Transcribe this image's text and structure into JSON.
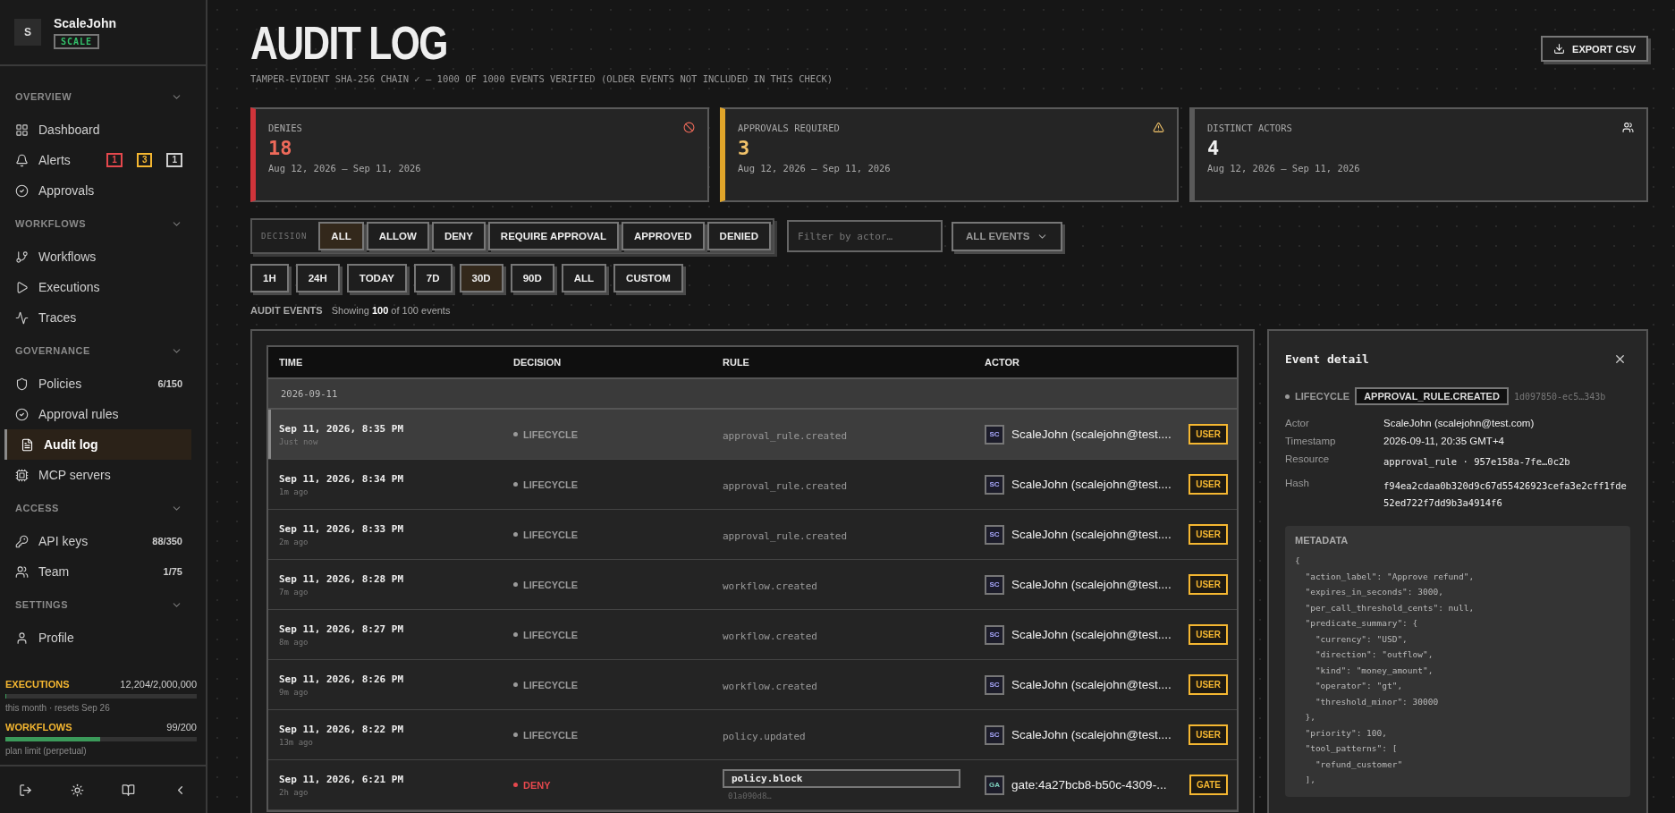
{
  "workspace": {
    "initial": "S",
    "name": "ScaleJohn",
    "plan": "SCALE"
  },
  "nav": [
    {
      "title": "OVERVIEW",
      "items": [
        {
          "label": "Dashboard",
          "selected": false
        },
        {
          "label": "Alerts",
          "selected": false,
          "badges": [
            {
              "text": "1",
              "color": "#e5484d"
            },
            {
              "text": "3",
              "color": "#f5b731"
            },
            {
              "text": "1",
              "color": "#cfcfcf"
            }
          ]
        },
        {
          "label": "Approvals",
          "selected": false
        }
      ]
    },
    {
      "title": "WORKFLOWS",
      "items": [
        {
          "label": "Workflows",
          "selected": false
        },
        {
          "label": "Executions",
          "selected": false
        },
        {
          "label": "Traces",
          "selected": false
        }
      ]
    },
    {
      "title": "GOVERNANCE",
      "items": [
        {
          "label": "Policies",
          "selected": false,
          "count": "6/150"
        },
        {
          "label": "Approval rules",
          "selected": false
        },
        {
          "label": "Audit log",
          "selected": true
        },
        {
          "label": "MCP servers",
          "selected": false
        }
      ]
    },
    {
      "title": "ACCESS",
      "items": [
        {
          "label": "API keys",
          "selected": false,
          "count": "88/350"
        },
        {
          "label": "Team",
          "selected": false,
          "count": "1/75"
        }
      ]
    },
    {
      "title": "SETTINGS",
      "items": [
        {
          "label": "Profile",
          "selected": false
        }
      ]
    }
  ],
  "usage": [
    {
      "title": "EXECUTIONS",
      "value": "12,204/2,000,000",
      "level": 0.006,
      "caption": "this month · resets Sep 26",
      "color": "#3b9a5a"
    },
    {
      "title": "WORKFLOWS",
      "value": "99/200",
      "level": 0.495,
      "caption": "plan limit (perpetual)",
      "color": "#3b9a5a"
    }
  ],
  "header": {
    "title": "AUDIT LOG",
    "subtitle": "TAMPER-EVIDENT SHA-256 CHAIN ✓ — 1000 OF 1000 EVENTS VERIFIED (OLDER EVENTS NOT INCLUDED IN THIS CHECK)",
    "export": "EXPORT CSV"
  },
  "stats": [
    {
      "kind": "deny",
      "label": "DENIES",
      "value": "18",
      "range": "Aug 12, 2026 – Sep 11, 2026"
    },
    {
      "kind": "approval",
      "label": "APPROVALS REQUIRED",
      "value": "3",
      "range": "Aug 12, 2026 – Sep 11, 2026"
    },
    {
      "kind": "actors",
      "label": "DISTINCT ACTORS",
      "value": "4",
      "range": "Aug 12, 2026 – Sep 11, 2026"
    }
  ],
  "decision_filter": {
    "label": "DECISION",
    "options": [
      {
        "label": "ALL",
        "selected": true
      },
      {
        "label": "ALLOW",
        "selected": false
      },
      {
        "label": "DENY",
        "selected": false
      },
      {
        "label": "REQUIRE APPROVAL",
        "selected": false
      },
      {
        "label": "APPROVED",
        "selected": false
      },
      {
        "label": "DENIED",
        "selected": false
      }
    ]
  },
  "actor_filter": {
    "placeholder": "Filter by actor…"
  },
  "event_select": {
    "value": "ALL EVENTS"
  },
  "time_filter": [
    {
      "label": "1H",
      "selected": false
    },
    {
      "label": "24H",
      "selected": false
    },
    {
      "label": "TODAY",
      "selected": false
    },
    {
      "label": "7D",
      "selected": false
    },
    {
      "label": "30D",
      "selected": true
    },
    {
      "label": "90D",
      "selected": false
    },
    {
      "label": "ALL",
      "selected": false
    },
    {
      "label": "CUSTOM",
      "selected": false
    }
  ],
  "events_summary": {
    "title": "AUDIT EVENTS",
    "text": "Showing **100** of 100 events"
  },
  "table": {
    "columns": [
      "TIME",
      "DECISION",
      "RULE",
      "ACTOR"
    ],
    "date_group": "2026-09-11",
    "rows": [
      {
        "selected": true,
        "time": "Sep 11, 2026, 8:35 PM",
        "ago": "Just now",
        "decision": {
          "kind": "lifecycle",
          "label": "LIFECYCLE"
        },
        "rule": {
          "kind": "plain",
          "text": "approval_rule.created"
        },
        "actor": {
          "initials": "SC",
          "name": "ScaleJohn (scalejohn@test....",
          "role": "USER"
        }
      },
      {
        "selected": false,
        "time": "Sep 11, 2026, 8:34 PM",
        "ago": "1m ago",
        "decision": {
          "kind": "lifecycle",
          "label": "LIFECYCLE"
        },
        "rule": {
          "kind": "plain",
          "text": "approval_rule.created"
        },
        "actor": {
          "initials": "SC",
          "name": "ScaleJohn (scalejohn@test....",
          "role": "USER"
        }
      },
      {
        "selected": false,
        "time": "Sep 11, 2026, 8:33 PM",
        "ago": "2m ago",
        "decision": {
          "kind": "lifecycle",
          "label": "LIFECYCLE"
        },
        "rule": {
          "kind": "plain",
          "text": "approval_rule.created"
        },
        "actor": {
          "initials": "SC",
          "name": "ScaleJohn (scalejohn@test....",
          "role": "USER"
        }
      },
      {
        "selected": false,
        "time": "Sep 11, 2026, 8:28 PM",
        "ago": "7m ago",
        "decision": {
          "kind": "lifecycle",
          "label": "LIFECYCLE"
        },
        "rule": {
          "kind": "plain",
          "text": "workflow.created"
        },
        "actor": {
          "initials": "SC",
          "name": "ScaleJohn (scalejohn@test....",
          "role": "USER"
        }
      },
      {
        "selected": false,
        "time": "Sep 11, 2026, 8:27 PM",
        "ago": "8m ago",
        "decision": {
          "kind": "lifecycle",
          "label": "LIFECYCLE"
        },
        "rule": {
          "kind": "plain",
          "text": "workflow.created"
        },
        "actor": {
          "initials": "SC",
          "name": "ScaleJohn (scalejohn@test....",
          "role": "USER"
        }
      },
      {
        "selected": false,
        "time": "Sep 11, 2026, 8:26 PM",
        "ago": "9m ago",
        "decision": {
          "kind": "lifecycle",
          "label": "LIFECYCLE"
        },
        "rule": {
          "kind": "plain",
          "text": "workflow.created"
        },
        "actor": {
          "initials": "SC",
          "name": "ScaleJohn (scalejohn@test....",
          "role": "USER"
        }
      },
      {
        "selected": false,
        "time": "Sep 11, 2026, 8:22 PM",
        "ago": "13m ago",
        "decision": {
          "kind": "lifecycle",
          "label": "LIFECYCLE"
        },
        "rule": {
          "kind": "plain",
          "text": "policy.updated"
        },
        "actor": {
          "initials": "SC",
          "name": "ScaleJohn (scalejohn@test....",
          "role": "USER"
        }
      },
      {
        "selected": false,
        "time": "Sep 11, 2026, 6:21 PM",
        "ago": "2h ago",
        "decision": {
          "kind": "deny",
          "label": "DENY"
        },
        "rule": {
          "kind": "boxed",
          "text": "policy.block",
          "sub": "01a090d8…"
        },
        "actor": {
          "initials": "GA",
          "name": "gate:4a27bcb8-b50c-4309-...",
          "role": "GATE"
        }
      }
    ]
  },
  "detail": {
    "title": "Event detail",
    "category": "LIFECYCLE",
    "event": "APPROVAL_RULE.CREATED",
    "id": "1d097850-ec5…343b",
    "fields": [
      {
        "label": "Actor",
        "value": "ScaleJohn (scalejohn@test.com)",
        "kind": "text"
      },
      {
        "label": "Timestamp",
        "value": "2026-09-11, 20:35 GMT+4",
        "kind": "text"
      },
      {
        "label": "Resource",
        "value": "approval_rule · 957e158a-7fe…0c2b",
        "kind": "mono"
      },
      {
        "label": "Hash",
        "value": "f94ea2cdaa0b320d9c67d55426923cefa3e2cff1fde52ed722f7dd9b3a4914f6",
        "kind": "mono"
      }
    ],
    "metadata_title": "METADATA",
    "metadata": [
      "{",
      "  \"action_label\": \"Approve refund\",",
      "  \"expires_in_seconds\": 3000,",
      "  \"per_call_threshold_cents\": null,",
      "  \"predicate_summary\": {",
      "    \"currency\": \"USD\",",
      "    \"direction\": \"outflow\",",
      "    \"kind\": \"money_amount\",",
      "    \"operator\": \"gt\",",
      "    \"threshold_minor\": 30000",
      "  },",
      "  \"priority\": 100,",
      "  \"tool_patterns\": [",
      "    \"refund_customer\"",
      "  ],"
    ]
  }
}
